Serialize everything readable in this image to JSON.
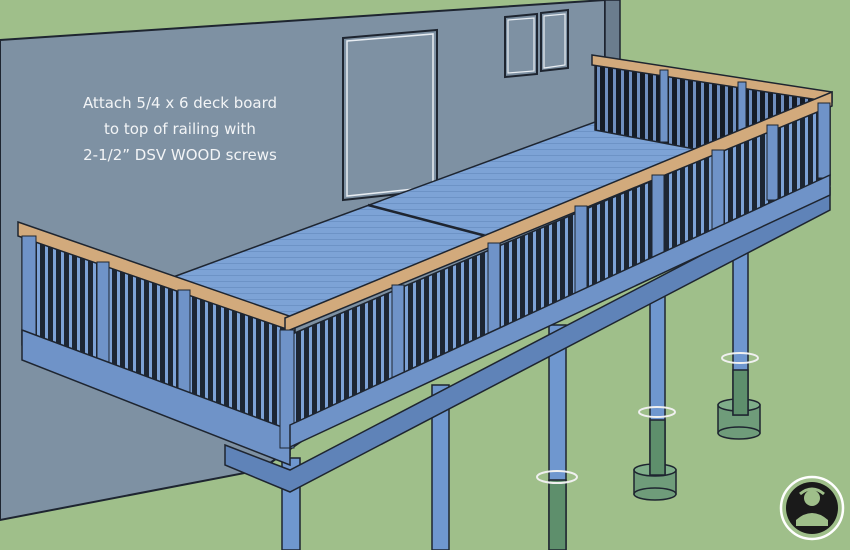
{
  "caption": {
    "lines": [
      "Attach 5/4 x 6 deck board",
      "to top of railing with",
      "2-1/2” DSV WOOD screws"
    ]
  },
  "colors": {
    "ground": "#9fbf8a",
    "house_wall": "#7e91a3",
    "deck_surface": "#7a9fd3",
    "deck_frame": "#6f93c8",
    "baluster": "#1d2633",
    "rail_cap": "#d2aa7c",
    "post": "#6f97cf",
    "concrete_footing": "#6f9c7a"
  },
  "icons": {
    "logo": "woodworker-badge-icon"
  }
}
